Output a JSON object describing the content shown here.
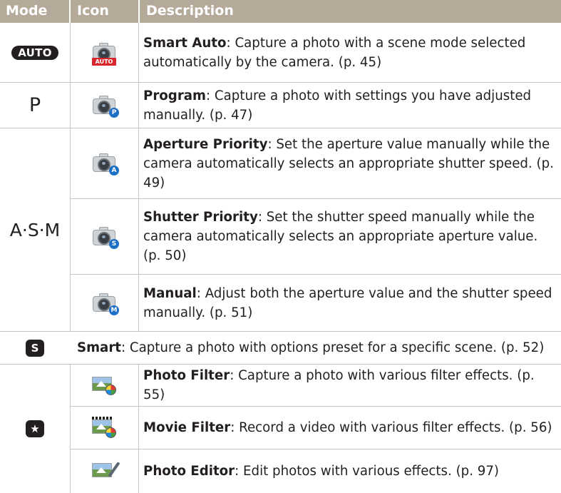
{
  "header": {
    "mode_label": "Mode",
    "icon_label": "Icon",
    "description_label": "Description"
  },
  "colors": {
    "header_bg": "#b5a99a",
    "text": "#231f20",
    "rule": "#c4c4c4",
    "badge_blue": "#1e6fc6",
    "auto_red": "#d9262c"
  },
  "rows": [
    {
      "mode": "AUTO",
      "icon": "smart-auto-camera-icon",
      "icon_badge": "AUTO",
      "title": "Smart Auto",
      "text": ": Capture a photo with a scene mode selected automatically by the camera. (p. 45)"
    },
    {
      "mode": "P",
      "icon": "program-camera-icon",
      "icon_badge": "P",
      "title": "Program",
      "text": ": Capture a photo with settings you have adjusted manually. (p. 47)"
    },
    {
      "mode": "A·S·M",
      "icon": "aperture-priority-camera-icon",
      "icon_badge": "A",
      "title": "Aperture Priority",
      "text": ": Set the aperture value manually while the camera automatically selects an appropriate shutter speed. (p. 49)"
    },
    {
      "icon": "shutter-priority-camera-icon",
      "icon_badge": "S",
      "title": "Shutter Priority",
      "text": ": Set the shutter speed manually while the camera automatically selects an appropriate aperture value. (p. 50)"
    },
    {
      "icon": "manual-camera-icon",
      "icon_badge": "M",
      "title": "Manual",
      "text": ": Adjust both the aperture value and the shutter speed manually. (p. 51)"
    },
    {
      "mode": "S",
      "icon": "smart-mode-icon",
      "title": "Smart",
      "text": ": Capture a photo with options preset for a specific scene. (p. 52)"
    },
    {
      "mode": "★",
      "icon": "photo-filter-icon",
      "title": "Photo Filter",
      "text": ": Capture a photo with various filter effects. (p. 55)"
    },
    {
      "icon": "movie-filter-icon",
      "title": "Movie Filter",
      "text": ": Record a video with various filter effects. (p. 56)"
    },
    {
      "icon": "photo-editor-icon",
      "title": "Photo Editor",
      "text": ": Edit photos with various effects. (p. 97)"
    }
  ]
}
